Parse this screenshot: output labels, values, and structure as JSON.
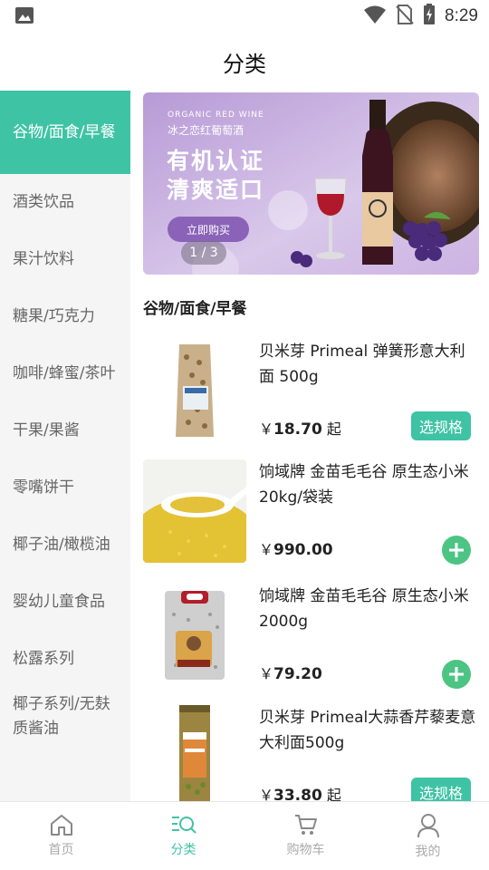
{
  "status_bar": {
    "time": "8:29"
  },
  "header": {
    "title": "分类"
  },
  "sidebar": {
    "items": [
      {
        "label": "谷物/面食/早餐"
      },
      {
        "label": "酒类饮品"
      },
      {
        "label": "果汁饮料"
      },
      {
        "label": "糖果/巧克力"
      },
      {
        "label": "咖啡/蜂蜜/茶叶"
      },
      {
        "label": "干果/果酱"
      },
      {
        "label": "零嘴饼干"
      },
      {
        "label": "椰子油/橄榄油"
      },
      {
        "label": "婴幼儿童食品"
      },
      {
        "label": "松露系列"
      },
      {
        "label": "椰子系列/无麸质酱油"
      }
    ]
  },
  "banner": {
    "small_text_en": "ORGANIC RED WINE",
    "small_text_cn": "冰之恋红葡萄酒",
    "headline_1": "有机认证",
    "headline_2": "清爽适口",
    "cta": "立即购买",
    "pager": "1 / 3"
  },
  "section": {
    "title": "谷物/面食/早餐"
  },
  "products": [
    {
      "name": "贝米芽 Primeal 弹簧形意大利面 500g",
      "currency": "￥",
      "price": "18.70",
      "suffix": " 起",
      "action": "选规格"
    },
    {
      "name": "饷域牌 金苗毛毛谷 原生态小米 20kg/袋装",
      "currency": "￥",
      "price": "990.00",
      "suffix": "",
      "action": "add"
    },
    {
      "name": "饷域牌 金苗毛毛谷 原生态小米 2000g",
      "currency": "￥",
      "price": "79.20",
      "suffix": "",
      "action": "add"
    },
    {
      "name": "贝米芽 Primeal大蒜香芹藜麦意大利面500g",
      "currency": "￥",
      "price": "33.80",
      "suffix": " 起",
      "action": "选规格"
    }
  ],
  "tabbar": {
    "tabs": [
      {
        "label": "首页",
        "icon": "home-icon"
      },
      {
        "label": "分类",
        "icon": "category-search-icon"
      },
      {
        "label": "购物车",
        "icon": "cart-icon"
      },
      {
        "label": "我的",
        "icon": "user-icon"
      }
    ]
  },
  "colors": {
    "accent": "#3fc3a5",
    "add_button": "#4cc483"
  }
}
